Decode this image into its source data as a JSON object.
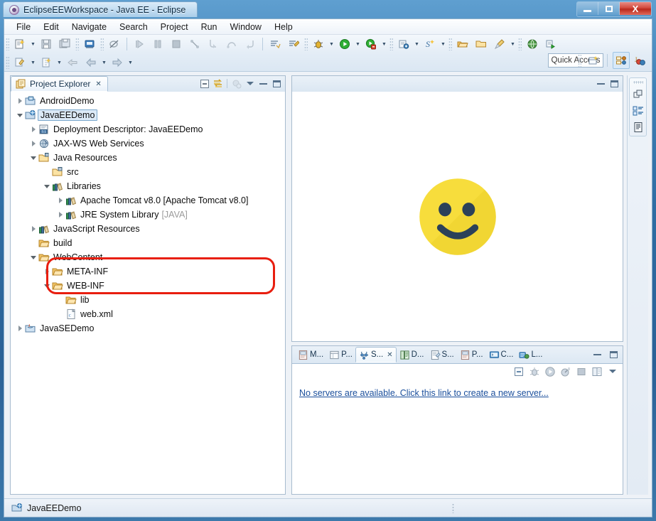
{
  "window": {
    "title": "EclipseEEWorkspace - Java EE - Eclipse",
    "logo_icon": "eclipse-logo-icon",
    "minimize_label": "Minimize",
    "maximize_label": "Maximize",
    "close_label": "X"
  },
  "menubar": {
    "items": [
      {
        "label": "File"
      },
      {
        "label": "Edit"
      },
      {
        "label": "Navigate"
      },
      {
        "label": "Search"
      },
      {
        "label": "Project"
      },
      {
        "label": "Run"
      },
      {
        "label": "Window"
      },
      {
        "label": "Help"
      }
    ]
  },
  "toolbar": {
    "quick_access_placeholder": "Quick Access",
    "row1": [
      {
        "icon": "new-wizard-icon",
        "dropdown": true
      },
      {
        "icon": "save-icon",
        "dropdown": false
      },
      {
        "icon": "save-all-icon",
        "dropdown": false
      },
      {
        "icon": "print-icon",
        "dropdown": false
      },
      {
        "icon": "toggle-breakpoint-off-icon",
        "dropdown": false
      },
      {
        "icon": "resume-icon",
        "dropdown": false
      },
      {
        "icon": "suspend-icon",
        "dropdown": false
      },
      {
        "icon": "terminate-icon",
        "dropdown": false
      },
      {
        "icon": "disconnect-icon",
        "dropdown": false
      },
      {
        "icon": "step-into-icon",
        "dropdown": false
      },
      {
        "icon": "step-over-icon",
        "dropdown": false
      },
      {
        "icon": "step-return-icon",
        "dropdown": false
      },
      {
        "icon": "open-task-icon",
        "dropdown": false
      },
      {
        "icon": "new-task-icon",
        "dropdown": false
      },
      {
        "icon": "debug-icon",
        "dropdown": true
      },
      {
        "icon": "run-icon",
        "dropdown": true
      },
      {
        "icon": "run-external-tools-icon",
        "dropdown": true
      },
      {
        "icon": "coverage-icon",
        "dropdown": true
      },
      {
        "icon": "new-java-project-icon",
        "dropdown": true
      },
      {
        "icon": "new-package-icon",
        "dropdown": false
      },
      {
        "icon": "open-type-icon",
        "dropdown": false
      },
      {
        "icon": "search-brush-icon",
        "dropdown": true
      },
      {
        "icon": "web-browser-icon",
        "dropdown": false
      },
      {
        "icon": "profile-icon",
        "dropdown": false
      }
    ],
    "row2": [
      {
        "icon": "annotation-icon",
        "dropdown": true
      },
      {
        "icon": "next-annotation-icon",
        "dropdown": true
      },
      {
        "icon": "previous-edit-icon",
        "dropdown": false
      },
      {
        "icon": "back-icon",
        "dropdown": true
      },
      {
        "icon": "forward-icon",
        "dropdown": true
      }
    ],
    "perspective": [
      {
        "icon": "open-perspective-icon",
        "active": false
      },
      {
        "icon": "java-ee-perspective-icon",
        "active": true
      },
      {
        "icon": "java-perspective-icon",
        "active": false
      }
    ]
  },
  "explorer": {
    "tab_label": "Project Explorer",
    "tab_icon": "project-explorer-icon",
    "close_icon": "close-icon",
    "tools": [
      {
        "icon": "collapse-all-icon"
      },
      {
        "icon": "link-with-editor-icon"
      },
      {
        "icon": "focus-on-active-task-icon"
      },
      {
        "icon": "view-menu-icon"
      },
      {
        "icon": "minimize-icon"
      },
      {
        "icon": "maximize-icon"
      }
    ],
    "tree": [
      {
        "indent": 0,
        "twisty": "right",
        "icon": "android-project-icon",
        "label": "AndroidDemo",
        "suffix": "",
        "selected": false
      },
      {
        "indent": 0,
        "twisty": "down",
        "icon": "web-project-icon",
        "label": "JavaEEDemo",
        "suffix": "",
        "selected": true
      },
      {
        "indent": 1,
        "twisty": "right",
        "icon": "deployment-descriptor-icon",
        "label": "Deployment Descriptor: JavaEEDemo",
        "suffix": "",
        "selected": false
      },
      {
        "indent": 1,
        "twisty": "right",
        "icon": "jax-ws-icon",
        "label": "JAX-WS Web Services",
        "suffix": "",
        "selected": false
      },
      {
        "indent": 1,
        "twisty": "down",
        "icon": "java-resources-icon",
        "label": "Java Resources",
        "suffix": "",
        "selected": false
      },
      {
        "indent": 2,
        "twisty": "none",
        "icon": "source-folder-icon",
        "label": "src",
        "suffix": "",
        "selected": false
      },
      {
        "indent": 2,
        "twisty": "down",
        "icon": "library-icon",
        "label": "Libraries",
        "suffix": "",
        "selected": false
      },
      {
        "indent": 3,
        "twisty": "right",
        "icon": "library-icon",
        "label": "Apache Tomcat v8.0 [Apache Tomcat v8.0]",
        "suffix": "",
        "selected": false
      },
      {
        "indent": 3,
        "twisty": "right",
        "icon": "library-icon",
        "label": "JRE System Library",
        "suffix": "[JAVA]",
        "selected": false
      },
      {
        "indent": 1,
        "twisty": "right",
        "icon": "library-icon",
        "label": "JavaScript Resources",
        "suffix": "",
        "selected": false
      },
      {
        "indent": 1,
        "twisty": "none",
        "icon": "folder-icon",
        "label": "build",
        "suffix": "",
        "selected": false
      },
      {
        "indent": 1,
        "twisty": "down",
        "icon": "folder-icon",
        "label": "WebContent",
        "suffix": "",
        "selected": false
      },
      {
        "indent": 2,
        "twisty": "right",
        "icon": "folder-icon",
        "label": "META-INF",
        "suffix": "",
        "selected": false
      },
      {
        "indent": 2,
        "twisty": "down",
        "icon": "folder-icon",
        "label": "WEB-INF",
        "suffix": "",
        "selected": false
      },
      {
        "indent": 3,
        "twisty": "none",
        "icon": "folder-icon",
        "label": "lib",
        "suffix": "",
        "selected": false
      },
      {
        "indent": 3,
        "twisty": "none",
        "icon": "xml-file-icon",
        "label": "web.xml",
        "suffix": "",
        "selected": false
      },
      {
        "indent": 0,
        "twisty": "right",
        "icon": "java-project-icon",
        "label": "JavaSEDemo",
        "suffix": "",
        "selected": false
      }
    ],
    "annotation": {
      "shape": "rounded-rectangle",
      "color": "#e81e0f",
      "target": "Libraries subtree"
    }
  },
  "editor": {
    "content_icon": "smiley-face-emoji",
    "smiley_color": "#f5d832",
    "smiley_feature_color": "#23395b",
    "minimize_icon": "minimize-icon",
    "maximize_icon": "maximize-icon"
  },
  "servers_view": {
    "tabs": [
      {
        "label": "M...",
        "icon": "markers-icon",
        "active": false,
        "closable": false
      },
      {
        "label": "P...",
        "icon": "properties-icon",
        "active": false,
        "closable": false
      },
      {
        "label": "S...",
        "icon": "servers-icon",
        "active": true,
        "closable": true
      },
      {
        "label": "D...",
        "icon": "data-source-explorer-icon",
        "active": false,
        "closable": false
      },
      {
        "label": "S...",
        "icon": "snippets-icon",
        "active": false,
        "closable": false
      },
      {
        "label": "P...",
        "icon": "problems-icon",
        "active": false,
        "closable": false
      },
      {
        "label": "C...",
        "icon": "console-icon",
        "active": false,
        "closable": false
      },
      {
        "label": "L...",
        "icon": "liferay-icon",
        "active": false,
        "closable": false
      }
    ],
    "window_controls": [
      {
        "icon": "minimize-icon"
      },
      {
        "icon": "maximize-icon"
      }
    ],
    "tools": [
      {
        "icon": "collapse-all-icon"
      },
      {
        "icon": "debug-server-icon"
      },
      {
        "icon": "start-server-icon"
      },
      {
        "icon": "profile-server-icon"
      },
      {
        "icon": "stop-server-icon"
      },
      {
        "icon": "publish-icon"
      },
      {
        "icon": "view-menu-icon"
      }
    ],
    "empty_message": "No servers are available. Click this link to create a new server...",
    "link_color": "#1b4f9c"
  },
  "fastview": {
    "icons": [
      {
        "icon": "restore-view-icon"
      },
      {
        "icon": "outline-view-icon"
      },
      {
        "icon": "task-list-view-icon"
      }
    ]
  },
  "statusbar": {
    "icon": "web-project-icon",
    "text": "JavaEEDemo"
  }
}
